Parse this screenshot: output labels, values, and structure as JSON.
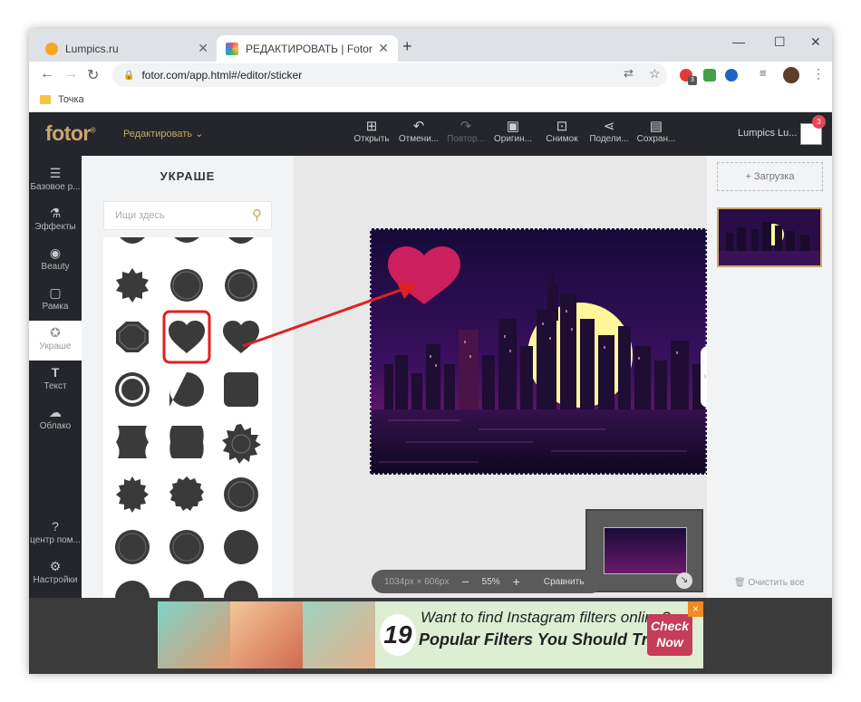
{
  "browser": {
    "tabs": [
      {
        "title": "Lumpics.ru",
        "favicon_color": "#f5a623"
      },
      {
        "title": "РЕДАКТИРОВАТЬ | Fotor",
        "favicon_color": "#e44c7a"
      }
    ],
    "url": "fotor.com/app.html#/editor/sticker",
    "bookmark": "Точка",
    "extension_badge": "3"
  },
  "app": {
    "logo": "fotor",
    "edit_menu": "Редактировать",
    "tools": [
      "Открыть",
      "Отмени...",
      "Повтор...",
      "Оригин...",
      "Снимок",
      "Подели...",
      "Сохран..."
    ],
    "user": "Lumpics Lu...",
    "notifications": "3"
  },
  "sidebar": {
    "items": [
      "Базовое р...",
      "Эффекты",
      "Beauty",
      "Рамка",
      "Украше",
      "Текст",
      "Облако"
    ],
    "bottom": [
      "центр пом...",
      "Настройки"
    ]
  },
  "panel": {
    "title": "УКРАШЕ",
    "search_placeholder": "Ищи здесь"
  },
  "canvas": {
    "size_label": "1034px × 606px",
    "zoom": "55%",
    "zoom_minus": "−",
    "zoom_plus": "+",
    "compare": "Сравнить"
  },
  "right_panel": {
    "upload": "Загрузка",
    "clear": "Очистить все"
  },
  "ad": {
    "number": "19",
    "line1": "Want to find Instagram filters online?",
    "line2": "Popular Filters You Should Try",
    "cta1": "Check",
    "cta2": "Now",
    "close": "×"
  },
  "colors": {
    "accent": "#c9a76d",
    "highlight": "#e02020",
    "heart": "#cc1f5e"
  }
}
